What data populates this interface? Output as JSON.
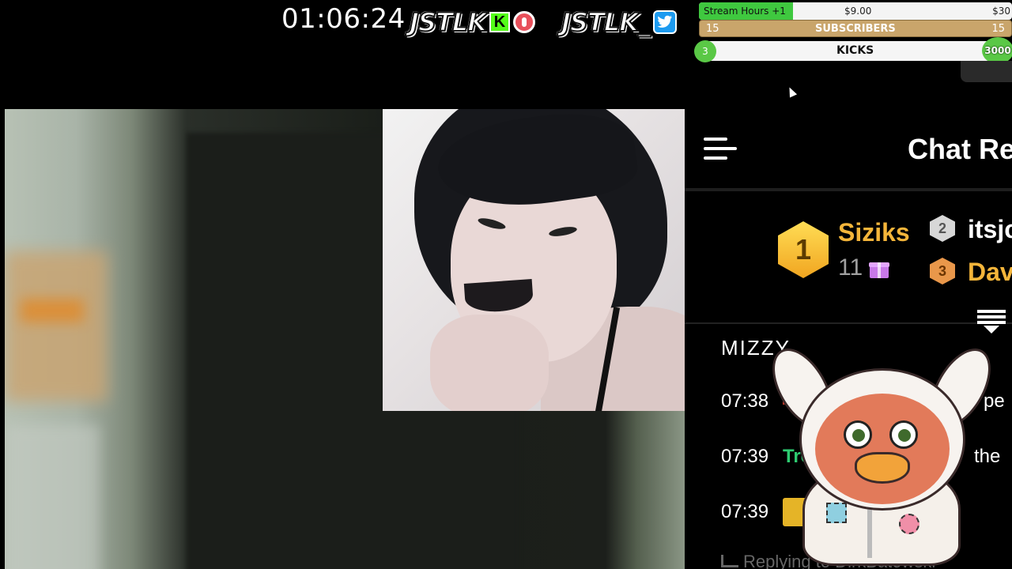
{
  "header": {
    "timer": "01:06:24",
    "brand_kick": "JSTLK",
    "kick_letter": "K",
    "brand_twitter": "JSTLK_"
  },
  "goals": {
    "stream_hours": {
      "label": "Stream Hours +1",
      "mid_value": "$9.00",
      "end_value": "$30",
      "progress": 0.3
    },
    "subscribers": {
      "label": "SUBSCRIBERS",
      "left_value": "15",
      "right_value": "15",
      "progress": 1.0
    },
    "kicks": {
      "label": "KICKS",
      "current": "3",
      "goal": "3000",
      "progress": 0.001
    }
  },
  "chat": {
    "title": "Chat Re",
    "leaderboard": [
      {
        "rank": "1",
        "name": "Siziks",
        "count": "11",
        "color": "#f4b53a"
      },
      {
        "rank": "2",
        "name": "itsjc",
        "color": "#ffffff"
      },
      {
        "rank": "3",
        "name": "Dav",
        "color": "#f4b53a"
      }
    ],
    "current_user": "MIZZY",
    "messages": [
      {
        "time": "07:38",
        "fragment": "pe"
      },
      {
        "time": "07:39",
        "prefix": "Tre",
        "fragment": "the"
      },
      {
        "time": "07:39"
      }
    ],
    "reply_text": "Replying to DirkBatowski"
  },
  "colors": {
    "accent_green": "#3fc83f",
    "gold": "#f4b53a",
    "sub_bar": "#c9a56b",
    "kick_green": "#53fc18",
    "twitter_blue": "#1d9bf0"
  },
  "icons": [
    "kick-logo-icon",
    "record-icon",
    "twitter-icon",
    "hamburger-menu-icon",
    "gift-icon",
    "scroll-down-icon",
    "reply-icon",
    "mascot-bunny-bird"
  ]
}
